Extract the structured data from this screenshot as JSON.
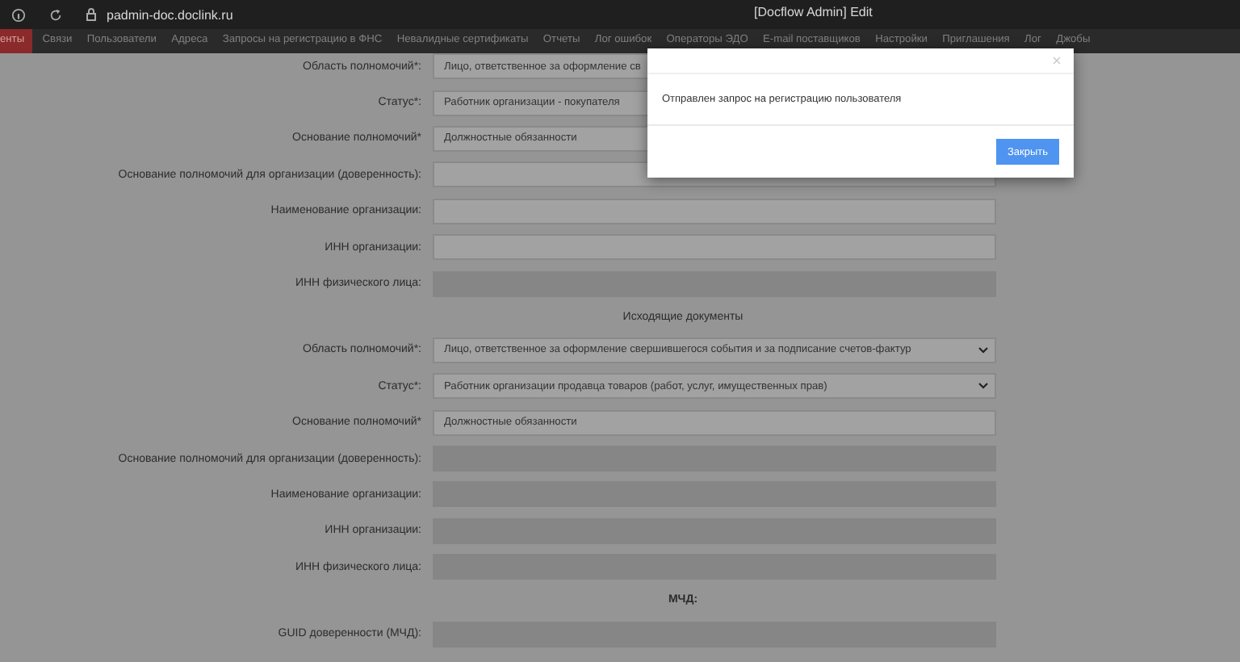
{
  "browser": {
    "url": "padmin-doc.doclink.ru",
    "title": "[Docflow Admin] Edit"
  },
  "nav": [
    {
      "label": "енты",
      "selected": true
    },
    {
      "label": "Связи",
      "selected": false
    },
    {
      "label": "Пользователи",
      "selected": false
    },
    {
      "label": "Адреса",
      "selected": false
    },
    {
      "label": "Запросы на регистрацию в ФНС",
      "selected": false
    },
    {
      "label": "Невалидные сертификаты",
      "selected": false
    },
    {
      "label": "Отчеты",
      "selected": false
    },
    {
      "label": "Лог ошибок",
      "selected": false
    },
    {
      "label": "Операторы ЭДО",
      "selected": false
    },
    {
      "label": "E-mail поставщиков",
      "selected": false
    },
    {
      "label": "Настройки",
      "selected": false
    },
    {
      "label": "Приглашения",
      "selected": false
    },
    {
      "label": "Лог",
      "selected": false
    },
    {
      "label": "Джобы",
      "selected": false
    }
  ],
  "form": {
    "sections": [
      {
        "rows": [
          {
            "label": "Область полномочий*:",
            "kind": "select",
            "value": "Лицо, ответственное за оформление св",
            "disabled": false
          },
          {
            "label": "Статус*:",
            "kind": "select",
            "value": "Работник организации - покупателя",
            "disabled": false
          },
          {
            "label": "Основание полномочий*",
            "kind": "text",
            "value": "Должностные обязанности",
            "disabled": false
          },
          {
            "label": "Основание полномочий для организации (доверенность):",
            "kind": "text",
            "disabled": false
          },
          {
            "label": "Наименование организации:",
            "kind": "text",
            "disabled": false
          },
          {
            "label": "ИНН организации:",
            "kind": "text",
            "disabled": false
          },
          {
            "label": "ИНН физического лица:",
            "kind": "text",
            "disabled": true
          }
        ]
      },
      {
        "heading": "Исходящие документы",
        "bold": false,
        "rows": [
          {
            "label": "Область полномочий*:",
            "kind": "select",
            "value": "Лицо, ответственное за оформление свершившегося события и за подписание счетов-фактур",
            "disabled": false
          },
          {
            "label": "Статус*:",
            "kind": "select",
            "value": "Работник организации продавца товаров (работ, услуг, имущественных прав)",
            "disabled": false
          },
          {
            "label": "Основание полномочий*",
            "kind": "text",
            "value": "Должностные обязанности",
            "disabled": false
          },
          {
            "label": "Основание полномочий для организации (доверенность):",
            "kind": "text",
            "disabled": true
          },
          {
            "label": "Наименование организации:",
            "kind": "text",
            "disabled": true
          },
          {
            "label": "ИНН организации:",
            "kind": "text",
            "disabled": true
          },
          {
            "label": "ИНН физического лица:",
            "kind": "text",
            "disabled": true
          }
        ]
      },
      {
        "heading": "МЧД:",
        "bold": true,
        "rows": [
          {
            "label": "GUID доверенности (МЧД):",
            "kind": "text",
            "disabled": true
          }
        ]
      }
    ]
  },
  "dialog": {
    "message": "Отправлен запрос на регистрацию пользователя",
    "button": "Закрыть"
  }
}
